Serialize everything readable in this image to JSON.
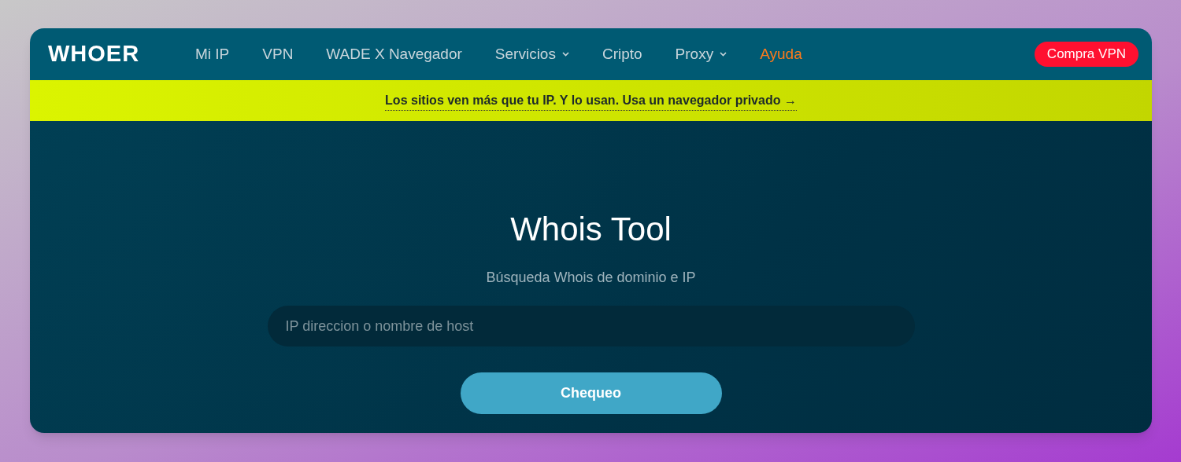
{
  "header": {
    "logo": "WHOER",
    "nav": [
      {
        "label": "Mi IP",
        "selected": false,
        "dropdown": false
      },
      {
        "label": "VPN",
        "selected": false,
        "dropdown": false
      },
      {
        "label": "WADE X Navegador",
        "selected": false,
        "dropdown": false
      },
      {
        "label": "Servicios",
        "selected": false,
        "dropdown": true
      },
      {
        "label": "Cripto",
        "selected": false,
        "dropdown": false
      },
      {
        "label": "Proxy",
        "selected": false,
        "dropdown": true
      },
      {
        "label": "Ayuda",
        "selected": true,
        "dropdown": false
      }
    ],
    "cta": "Compra VPN"
  },
  "banner": {
    "text": "Los sitios ven más que tu IP. Y lo usan. Usa un navegador privado →"
  },
  "main": {
    "title": "Whois Tool",
    "subtitle": "Búsqueda Whois de dominio e IP",
    "search": {
      "placeholder": "IP direccion o nombre de host"
    },
    "button": "Chequeo"
  }
}
